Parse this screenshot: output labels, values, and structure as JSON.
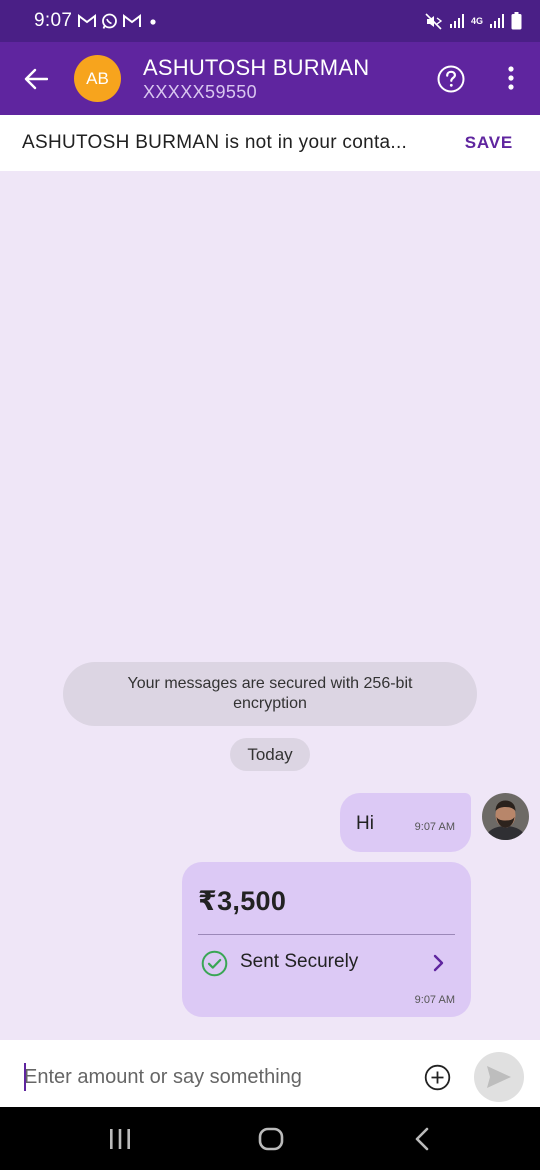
{
  "status_bar": {
    "time": "9:07",
    "left_icons": [
      "gmail-icon",
      "whatsapp-icon",
      "gmail-icon",
      "dot-icon"
    ],
    "network_label": "4G",
    "right_icons": [
      "mute-icon",
      "signal-icon",
      "4g-icon",
      "signal-icon",
      "battery-icon"
    ]
  },
  "header": {
    "avatar_initials": "AB",
    "contact_name": "ASHUTOSH BURMAN",
    "contact_number": "XXXXX59550",
    "avatar_color": "#f7a41d",
    "brand_color": "#5f259f"
  },
  "contact_banner": {
    "text": "ASHUTOSH BURMAN is not in your conta...",
    "save_label": "SAVE"
  },
  "chat": {
    "encryption_notice": "Your messages are secured with 256-bit encryption",
    "date_label": "Today",
    "messages": [
      {
        "text": "Hi",
        "time": "9:07 AM"
      }
    ],
    "payment": {
      "amount": "₹3,500",
      "status": "Sent Securely",
      "time": "9:07 AM",
      "status_color": "#3aa655"
    }
  },
  "composer": {
    "placeholder": "Enter amount or say something"
  },
  "nav_bar": {
    "icons": [
      "recents-icon",
      "home-icon",
      "back-icon"
    ]
  }
}
